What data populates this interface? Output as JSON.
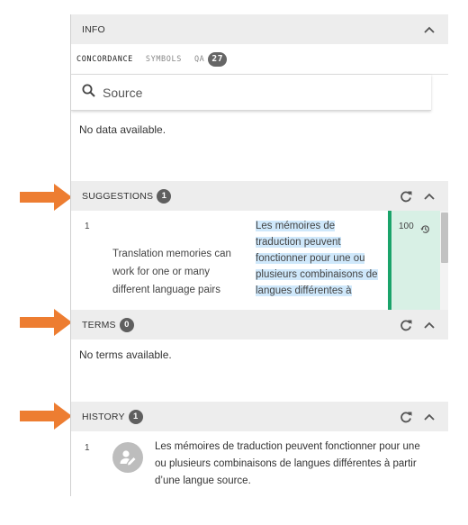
{
  "info": {
    "title": "INFO",
    "tabs": [
      {
        "label": "CONCORDANCE",
        "active": true
      },
      {
        "label": "SYMBOLS",
        "active": false
      },
      {
        "label": "QA",
        "active": false,
        "count": "27"
      }
    ],
    "search_placeholder": "Source",
    "empty_text": "No data available."
  },
  "suggestions": {
    "title": "SUGGESTIONS",
    "count": "1",
    "items": [
      {
        "index": "1",
        "source": "Translation memories can work for one or many different language pairs",
        "target": "Les mémoires de traduction peuvent fonctionner pour une ou plusieurs combinaisons de langues différentes à",
        "match": "100"
      }
    ]
  },
  "terms": {
    "title": "TERMS",
    "count": "0",
    "empty_text": "No terms available."
  },
  "history": {
    "title": "HISTORY",
    "count": "1",
    "items": [
      {
        "index": "1",
        "text": "Les mémoires de traduction peuvent fonctionner pour une ou plusieurs combinaisons de langues différentes à partir d’une langue source."
      }
    ]
  },
  "colors": {
    "arrow": "#ed7d31",
    "match_bar": "#1aa36a",
    "match_bg": "#d8f0e5",
    "highlight": "#cfe8fb",
    "header_bg": "#ededed"
  }
}
